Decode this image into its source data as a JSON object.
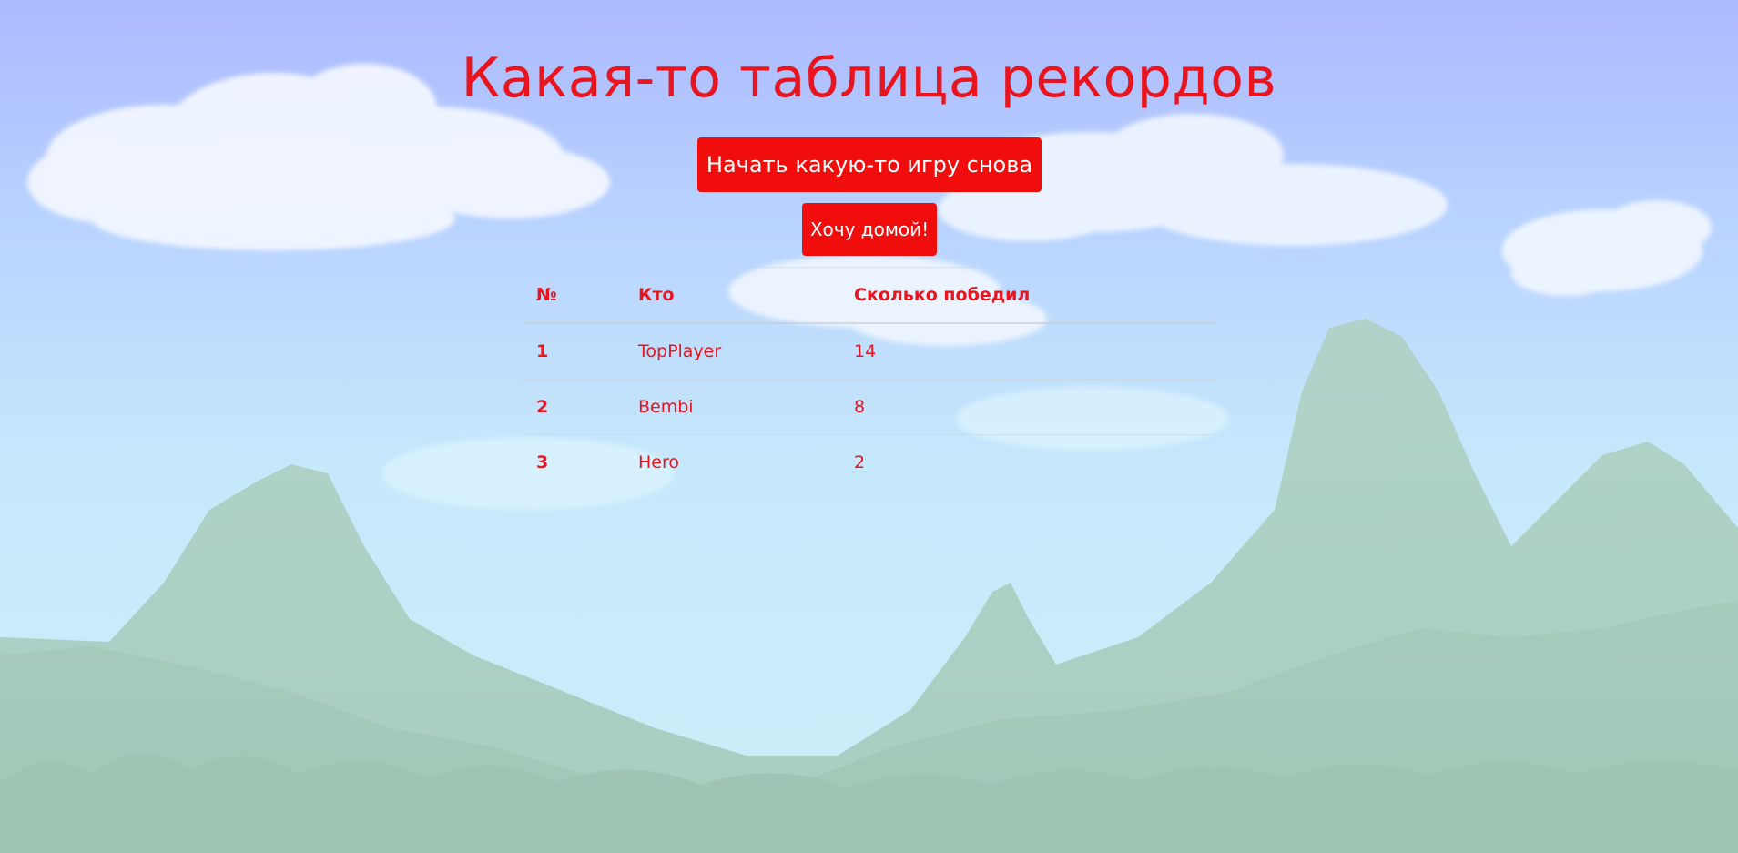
{
  "theme": {
    "accent": "#f20d0d",
    "text": "#e8141e",
    "button_text": "#ffffff",
    "sky_top": "#adbcff",
    "sky_bottom": "#cbeefa",
    "mountains": "#a3cbbd"
  },
  "page": {
    "title": "Какая-то таблица рекордов"
  },
  "buttons": {
    "restart_label": "Начать какую-то игру снова",
    "home_label": "Хочу домой!"
  },
  "table": {
    "headers": [
      "№",
      "Кто",
      "Сколько победил"
    ],
    "rows": [
      {
        "rank": "1",
        "name": "TopPlayer",
        "wins": "14"
      },
      {
        "rank": "2",
        "name": "Bembi",
        "wins": "8"
      },
      {
        "rank": "3",
        "name": "Hero",
        "wins": "2"
      }
    ]
  }
}
